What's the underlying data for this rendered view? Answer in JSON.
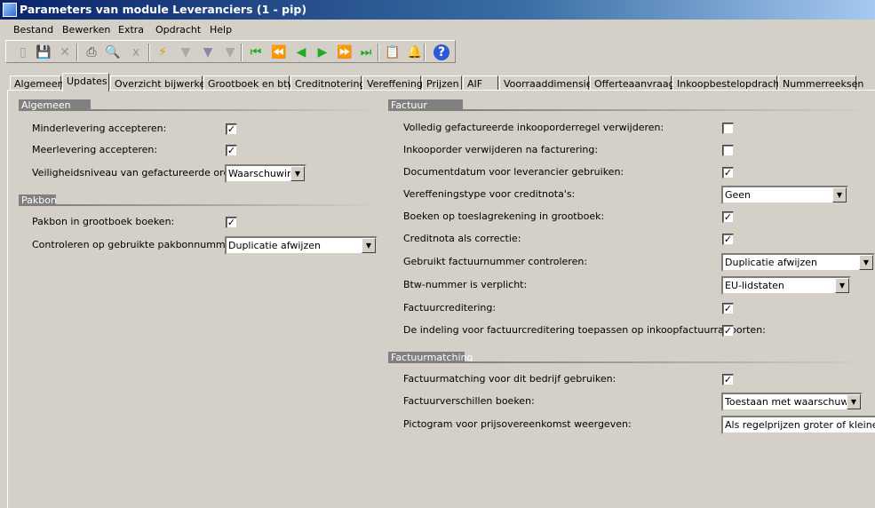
{
  "window": {
    "title": "Parameters van module Leveranciers (1 - pip)"
  },
  "menu": [
    "Bestand",
    "Bewerken",
    "Extra",
    "Opdracht",
    "Help"
  ],
  "toolbar": [
    "new-icon",
    "save-icon",
    "delete-icon",
    "print-icon",
    "print-preview-icon",
    "excel-icon",
    "filter-by-selection-icon",
    "filter-advanced-icon",
    "filter-edit-icon",
    "remove-filter-icon",
    "first-record-icon",
    "previous-page-icon",
    "previous-record-icon",
    "next-record-icon",
    "next-page-icon",
    "last-record-icon",
    "attachment-icon",
    "alert-icon",
    "help-icon"
  ],
  "tabs": [
    "Algemeen",
    "Updates",
    "Overzicht bijwerken",
    "Grootboek en btw",
    "Creditnotering",
    "Vereffening",
    "Prijzen",
    "AIF",
    "Voorraaddimensies",
    "Offerteaanvraag",
    "Inkoopbestelopdracht",
    "Nummerreeksen"
  ],
  "active_tab": "Updates",
  "groups": {
    "algemeen": {
      "title": "Algemeen",
      "rows": [
        {
          "label": "Minderlevering accepteren:",
          "type": "checkbox",
          "checked": true
        },
        {
          "label": "Meerlevering accepteren:",
          "type": "checkbox",
          "checked": true
        },
        {
          "label": "Veiligheidsniveau van gefactureerde orders:",
          "type": "select",
          "value": "Waarschuwing"
        }
      ]
    },
    "pakbon": {
      "title": "Pakbon",
      "rows": [
        {
          "label": "Pakbon in grootboek boeken:",
          "type": "checkbox",
          "checked": true
        },
        {
          "label": "Controleren op gebruikte pakbonnummer:",
          "type": "select",
          "value": "Duplicatie afwijzen"
        }
      ]
    },
    "factuur": {
      "title": "Factuur",
      "rows": [
        {
          "label": "Volledig gefactureerde inkooporderregel verwijderen:",
          "type": "checkbox",
          "checked": false
        },
        {
          "label": "Inkooporder verwijderen na facturering:",
          "type": "checkbox",
          "checked": false
        },
        {
          "label": "Documentdatum voor leverancier gebruiken:",
          "type": "checkbox",
          "checked": true
        },
        {
          "label": "Vereffeningstype voor creditnota's:",
          "type": "select",
          "value": "Geen"
        },
        {
          "label": "Boeken op toeslagrekening in grootboek:",
          "type": "checkbox",
          "checked": true
        },
        {
          "label": "Creditnota als correctie:",
          "type": "checkbox",
          "checked": true
        },
        {
          "label": "Gebruikt factuurnummer controleren:",
          "type": "select",
          "value": "Duplicatie afwijzen"
        },
        {
          "label": "Btw-nummer is verplicht:",
          "type": "select",
          "value": "EU-lidstaten"
        },
        {
          "label": "Factuurcreditering:",
          "type": "checkbox",
          "checked": true
        },
        {
          "label": "De indeling voor factuurcreditering toepassen op inkoopfactuurrapporten:",
          "type": "checkbox",
          "checked": true
        }
      ]
    },
    "factuurmatching": {
      "title": "Factuurmatching",
      "rows": [
        {
          "label": "Factuurmatching voor dit bedrijf gebruiken:",
          "type": "checkbox",
          "checked": true
        },
        {
          "label": "Factuurverschillen boeken:",
          "type": "select",
          "value": "Toestaan met waarschuwing"
        },
        {
          "label": "Pictogram voor prijsovereenkomst weergeven:",
          "type": "select",
          "value": "Als regelprijzen groter of kleiner zijn"
        }
      ]
    }
  }
}
